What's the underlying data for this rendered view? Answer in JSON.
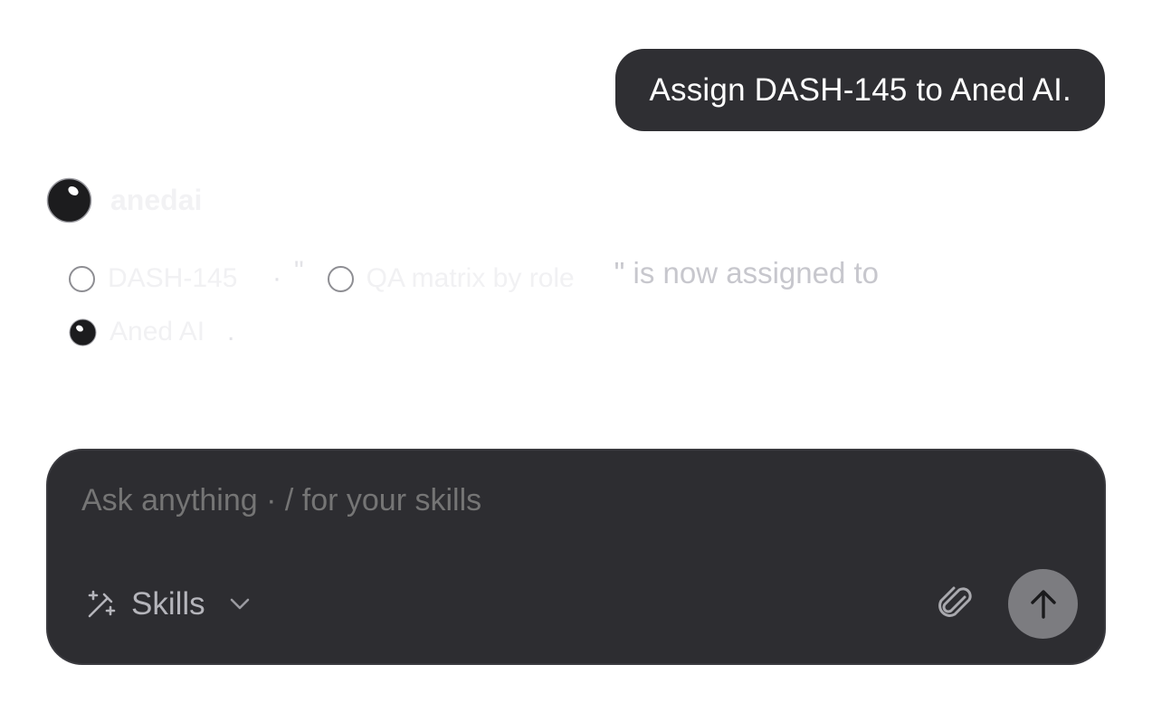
{
  "user_message": {
    "text": "Assign DASH-145 to Aned AI."
  },
  "assistant": {
    "name": "anedai",
    "avatar_icon": "assistant-avatar-icon",
    "response": {
      "issue_key": "DASH-145",
      "separator_1": "·",
      "open_quote": "\"",
      "issue_title": "QA matrix by role",
      "close_quote_and_text": "\" is now assigned to",
      "assignee": "Aned AI",
      "period": "."
    }
  },
  "composer": {
    "placeholder": "Ask anything · / for your skills",
    "skills_label": "Skills",
    "icons": {
      "skills": "magic-wand-icon",
      "dropdown": "chevron-down-icon",
      "attach": "paperclip-icon",
      "send": "arrow-up-icon"
    }
  },
  "colors": {
    "bubble_bg": "#2f2f33",
    "composer_bg": "#2d2d31",
    "send_button_bg": "#7c7c80",
    "placeholder_text": "#8e8e93"
  }
}
